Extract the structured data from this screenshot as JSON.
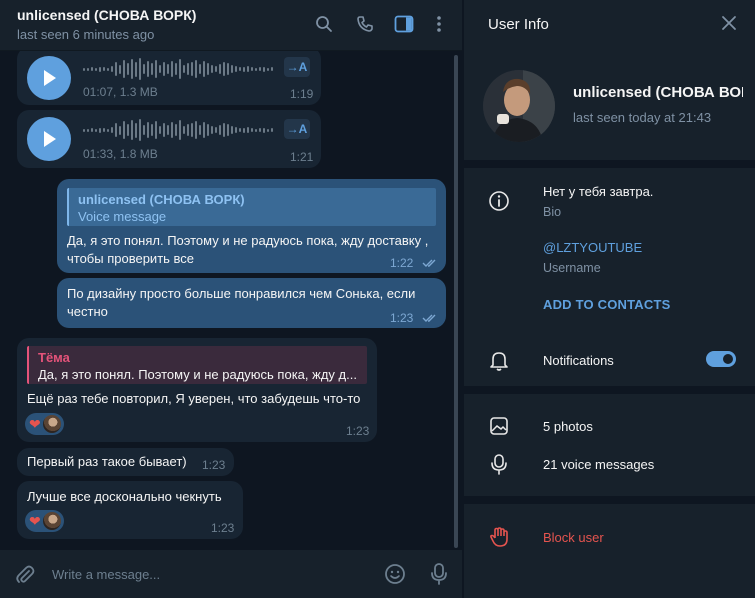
{
  "header": {
    "title": "unlicensed (СНОВА ВОРК)",
    "status": "last seen 6 minutes ago",
    "icons": [
      "search-icon",
      "phone-icon",
      "sidebar-toggle-icon",
      "more-vertical-icon"
    ]
  },
  "messages": {
    "voice_1": {
      "meta": "01:07, 1.3 MB",
      "time": "1:19",
      "transcribe": "→A"
    },
    "voice_2": {
      "meta": "01:33, 1.8 MB",
      "time": "1:21",
      "transcribe": "→A"
    },
    "out_1": {
      "reply_name": "unlicensed (СНОВА ВОРК)",
      "reply_text": "Voice message",
      "text": "Да, я это понял. Поэтому и не радуюсь пока, жду доставку , чтобы проверить все",
      "time": "1:22"
    },
    "out_2": {
      "text": "По дизайну просто больше понравился чем Сонька, если честно",
      "time": "1:23"
    },
    "in_1": {
      "reply_name": "Тёма",
      "reply_text": "Да, я это понял. Поэтому и не радуюсь пока, жду д...",
      "text": "Ещё раз тебе повторил, Я уверен, что забудешь что-то",
      "time": "1:23",
      "reaction": "❤"
    },
    "in_2": {
      "text": "Первый раз такое бывает)",
      "time": "1:23"
    },
    "in_3": {
      "text": "Лучше все досконально чекнуть",
      "time": "1:23",
      "reaction": "❤"
    }
  },
  "composer": {
    "placeholder": "Write a message...",
    "icons": [
      "attach-icon",
      "emoji-icon",
      "microphone-icon"
    ]
  },
  "user_info": {
    "title": "User Info",
    "name": "unlicensed (СНОВА ВОРК)",
    "status": "last seen today at 21:43",
    "bio": "Нет у тебя завтра.",
    "bio_label": "Bio",
    "username": "@LZTYOUTUBE",
    "username_label": "Username",
    "add_contacts": "ADD TO CONTACTS",
    "notifications": "Notifications",
    "notifications_on": true,
    "photos": "5 photos",
    "voice_messages": "21 voice messages",
    "block_user": "Block user"
  },
  "colors": {
    "accent": "#5fa0de",
    "outgoing_bubble": "#2b5278",
    "incoming_bubble": "#182533",
    "panel_bg": "#17212b",
    "chat_bg": "#0e1621",
    "reply_name_pink": "#e4537a",
    "danger": "#e5544f"
  }
}
